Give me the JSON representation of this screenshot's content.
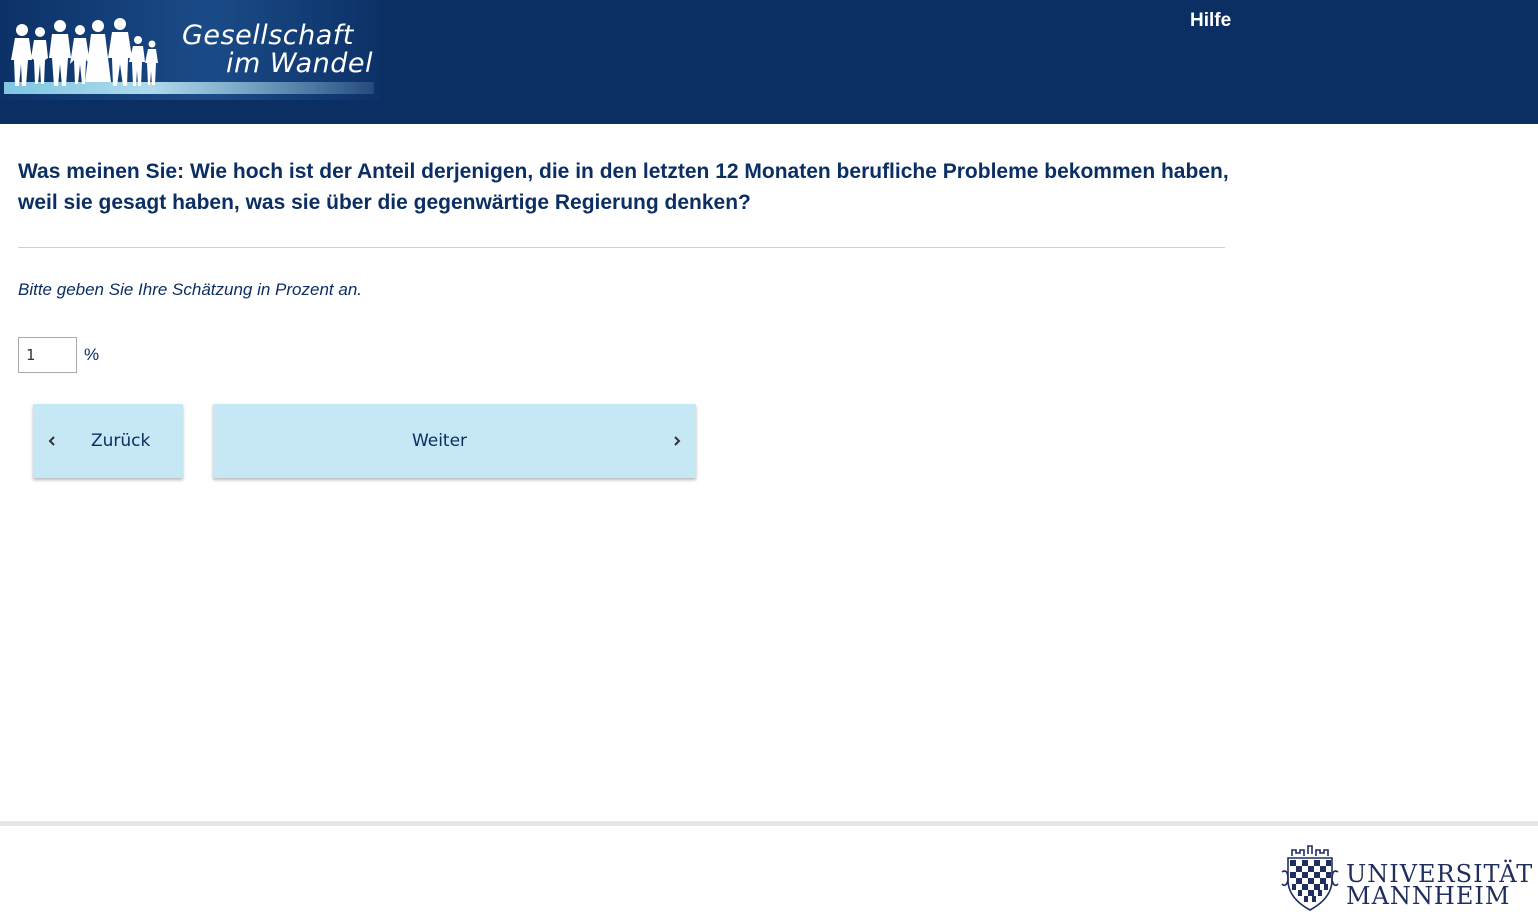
{
  "header": {
    "logo_line1": "Gesellschaft",
    "logo_line2": "im Wandel",
    "help_label": "Hilfe",
    "background_color": "#0b2f63"
  },
  "question": {
    "text": "Was meinen Sie: Wie hoch ist der Anteil derjenigen, die in den letzten 12 Monaten berufliche Probleme bekommen haben, weil sie gesagt haben, was sie über die gegenwärtige Regierung denken?",
    "instruction": "Bitte geben Sie Ihre Schätzung in Prozent an."
  },
  "answer": {
    "value": "1",
    "unit": "%"
  },
  "navigation": {
    "back_label": "Zurück",
    "next_label": "Weiter",
    "button_color": "#c6e7f4"
  },
  "footer": {
    "university_line1": "UNIVERSITÄT",
    "university_line2": "MANNHEIM"
  }
}
